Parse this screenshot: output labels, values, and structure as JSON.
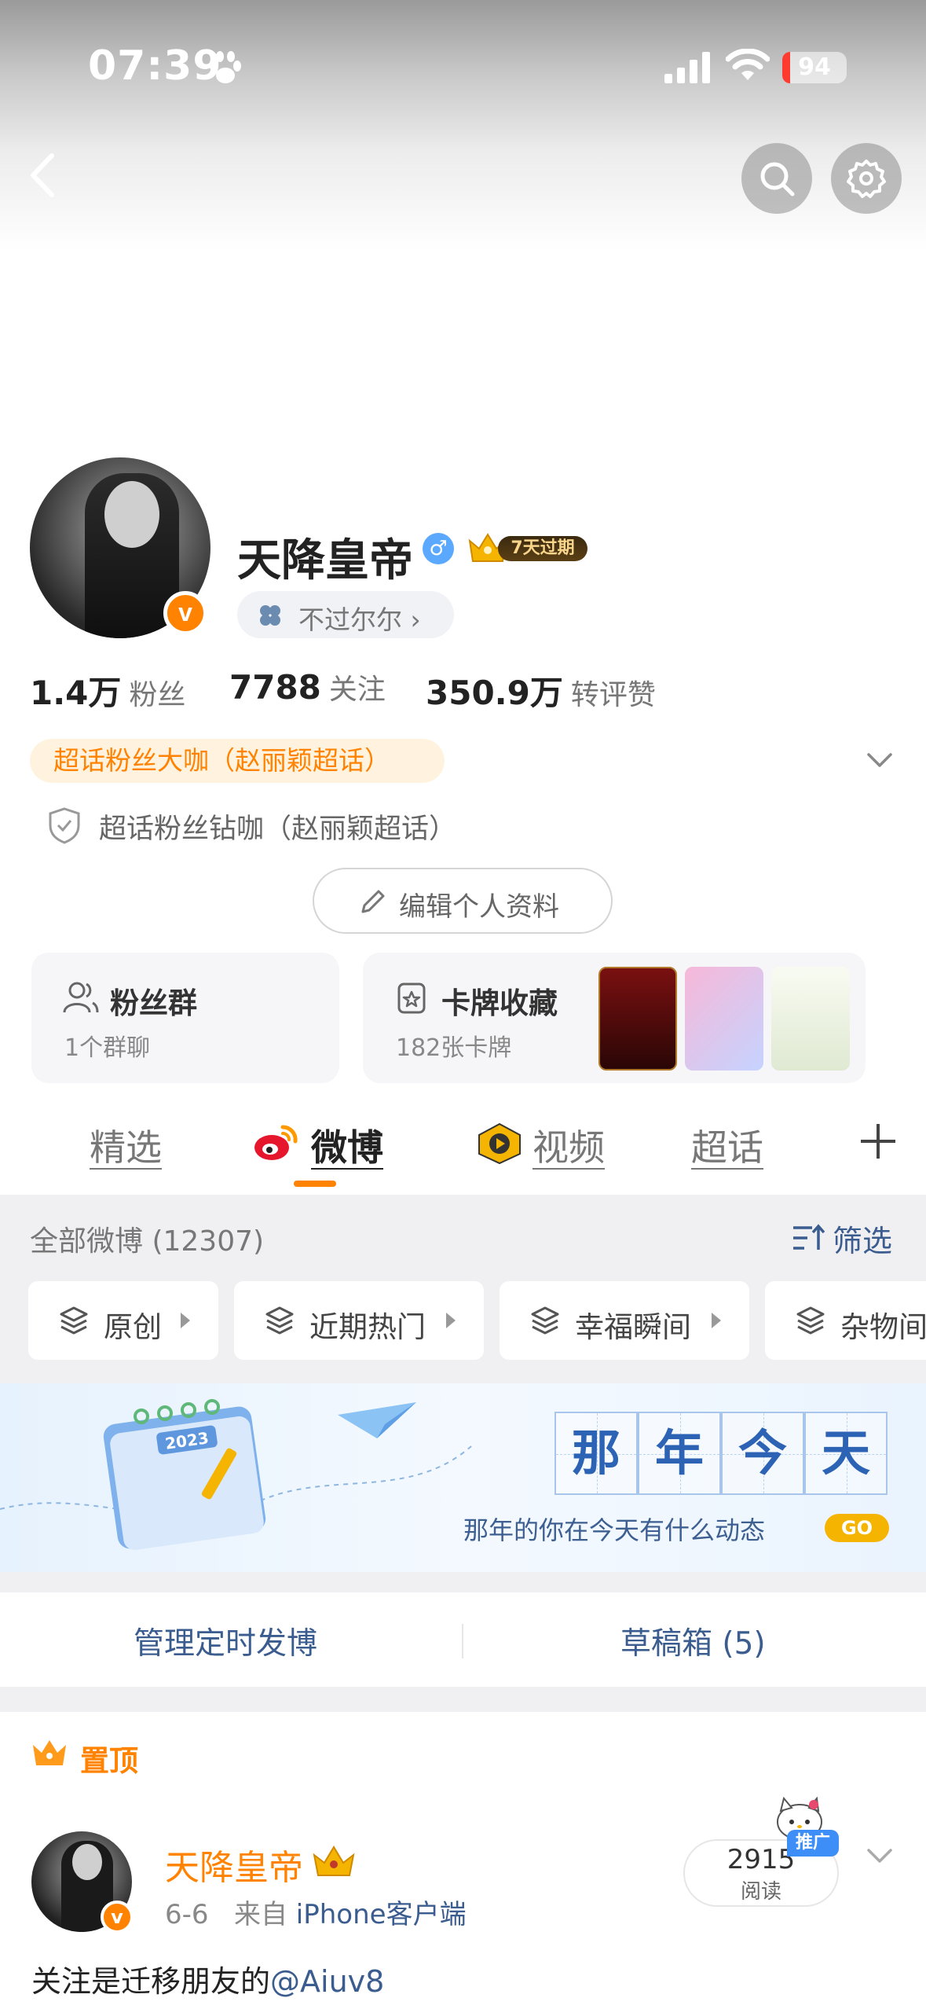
{
  "status_bar": {
    "time": "07:39",
    "battery": "94",
    "battery_level": 0.12
  },
  "profile": {
    "username": "天降皇帝",
    "gender_symbol": "♂",
    "vip_label": "7天过期",
    "tag": "不过尔尔",
    "tag_arrow": "›",
    "verified_mark": "v"
  },
  "stats": [
    {
      "num": "1.4万",
      "label": "粉丝"
    },
    {
      "num": "7788",
      "label": "关注"
    },
    {
      "num": "350.9万",
      "label": "转评赞"
    }
  ],
  "fan_titles": {
    "primary": "超话粉丝大咖（赵丽颖超话）",
    "secondary": "超话粉丝钻咖（赵丽颖超话）"
  },
  "edit_profile": "编辑个人资料",
  "cards": {
    "fan_group": {
      "title": "粉丝群",
      "sub": "1个群聊"
    },
    "card_collection": {
      "title": "卡牌收藏",
      "sub": "182张卡牌"
    }
  },
  "tabs": [
    {
      "label": "精选"
    },
    {
      "label": "微博"
    },
    {
      "label": "视频"
    },
    {
      "label": "超话"
    }
  ],
  "posts_header": {
    "all": "全部微博 (12307)",
    "filter": "筛选"
  },
  "chips": [
    {
      "label": "原创"
    },
    {
      "label": "近期热门"
    },
    {
      "label": "幸福瞬间"
    },
    {
      "label": "杂物间"
    }
  ],
  "banner": {
    "chars": [
      "那",
      "年",
      "今",
      "天"
    ],
    "subtitle": "那年的你在今天有什么动态",
    "go": "GO",
    "calendar_year": "2023"
  },
  "manage": {
    "scheduled": "管理定时发博",
    "drafts": "草稿箱 (5)"
  },
  "pinned": {
    "label": "置顶"
  },
  "post": {
    "name": "天降皇帝",
    "date": "6-6",
    "from": "来自",
    "source": "iPhone客户端",
    "reads": "2915",
    "reads_label": "阅读",
    "promo": "推广",
    "text_prefix": "关注是迁移朋友的",
    "mention": "@Aiuv8"
  },
  "colors": {
    "accent": "#ff8200",
    "link": "#3b5c8f",
    "promo": "#3e8ef7"
  }
}
